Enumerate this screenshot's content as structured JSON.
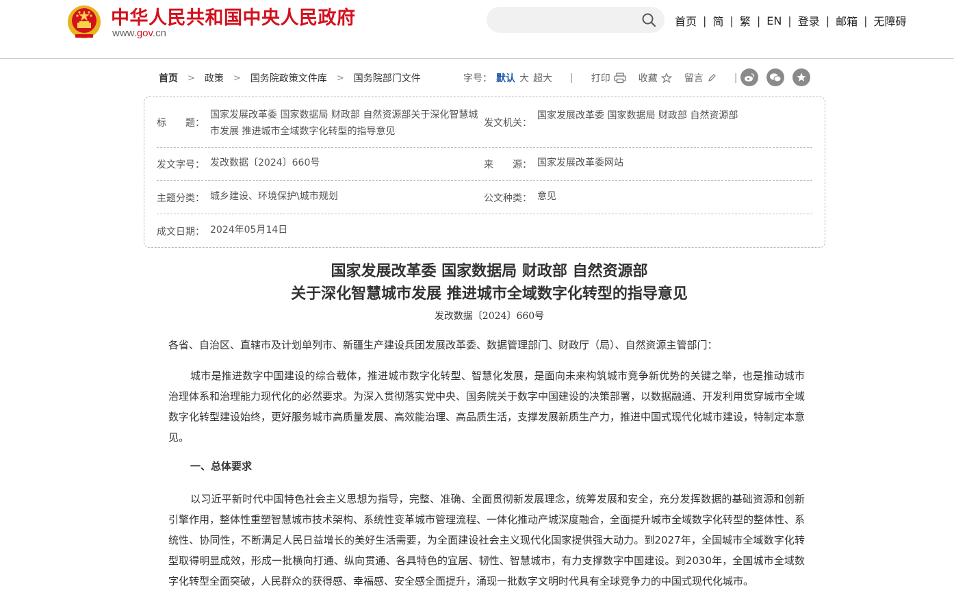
{
  "header": {
    "site_name": "中华人民共和国中央人民政府",
    "url_prefix": "www.",
    "url_gov": "gov",
    "url_suffix": ".cn",
    "search_placeholder": "",
    "nav": [
      "首页",
      "简",
      "繁",
      "EN",
      "登录",
      "邮箱",
      "无障碍"
    ],
    "nav_separator": "|"
  },
  "breadcrumb": {
    "items": [
      "首页",
      "政策",
      "国务院政策文件库",
      "国务院部门文件"
    ],
    "arrow": ">"
  },
  "tools": {
    "font_label": "字号：",
    "font_sizes": [
      "默认",
      "大",
      "超大"
    ],
    "separator": "|",
    "print": "打印",
    "favorite": "收藏",
    "comment": "留言"
  },
  "info": {
    "title_key": "标　　题：",
    "title_value": "国家发展改革委 国家数据局 财政部 自然资源部关于深化智慧城市发展 推进城市全域数字化转型的指导意见",
    "issuer_key": "发文机关：",
    "issuer_value": "国家发展改革委 国家数据局 财政部 自然资源部",
    "docno_key": "发文字号：",
    "docno_value": "发改数据〔2024〕660号",
    "source_key": "来　　源：",
    "source_value": "国家发展改革委网站",
    "topic_key": "主题分类：",
    "topic_value": "城乡建设、环境保护\\城市规划",
    "type_key": "公文种类：",
    "type_value": "意见",
    "date_key": "成文日期：",
    "date_value": "2024年05月14日"
  },
  "article": {
    "title_line1": "国家发展改革委 国家数据局 财政部 自然资源部",
    "title_line2": "关于深化智慧城市发展 推进城市全域数字化转型的指导意见",
    "doc_number": "发改数据〔2024〕660号",
    "salutation": "各省、自治区、直辖市及计划单列市、新疆生产建设兵团发展改革委、数据管理部门、财政厅（局）、自然资源主管部门：",
    "para1": "城市是推进数字中国建设的综合载体，推进城市数字化转型、智慧化发展，是面向未来构筑城市竞争新优势的关键之举，也是推动城市治理体系和治理能力现代化的必然要求。为深入贯彻落实党中央、国务院关于数字中国建设的决策部署，以数据融通、开发利用贯穿城市全域数字化转型建设始终，更好服务城市高质量发展、高效能治理、高品质生活，支撑发展新质生产力，推进中国式现代化城市建设，特制定本意见。",
    "heading1": "一、总体要求",
    "para2": "以习近平新时代中国特色社会主义思想为指导，完整、准确、全面贯彻新发展理念，统筹发展和安全，充分发挥数据的基础资源和创新引擎作用，整体性重塑智慧城市技术架构、系统性变革城市管理流程、一体化推动产城深度融合，全面提升城市全域数字化转型的整体性、系统性、协同性，不断满足人民日益增长的美好生活需要，为全面建设社会主义现代化国家提供强大动力。到2027年，全国城市全域数字化转型取得明显成效，形成一批横向打通、纵向贯通、各具特色的宜居、韧性、智慧城市，有力支撑数字中国建设。到2030年，全国城市全域数字化转型全面突破，人民群众的获得感、幸福感、安全感全面提升，涌现一批数字文明时代具有全球竞争力的中国式现代化城市。"
  },
  "colors": {
    "brand_red": "#d3111d",
    "link_blue": "#1f5aa8",
    "emblem_gold": "#e8b31c"
  }
}
